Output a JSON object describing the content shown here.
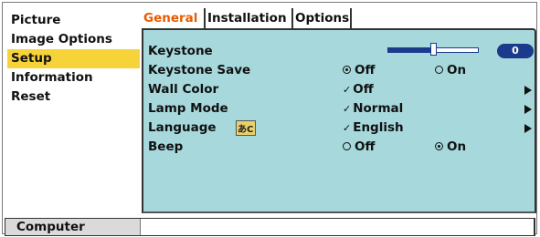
{
  "sidebar": {
    "items": [
      {
        "label": "Picture",
        "selected": false
      },
      {
        "label": "Image Options",
        "selected": false
      },
      {
        "label": "Setup",
        "selected": true
      },
      {
        "label": "Information",
        "selected": false
      },
      {
        "label": "Reset",
        "selected": false
      }
    ]
  },
  "tabs": [
    {
      "label": "General",
      "active": true
    },
    {
      "label": "Installation",
      "active": false
    },
    {
      "label": "Options",
      "active": false
    }
  ],
  "settings": {
    "keystone": {
      "label": "Keystone",
      "value": "0",
      "slider_fraction": 0.5
    },
    "keystone_save": {
      "label": "Keystone Save",
      "options": [
        "Off",
        "On"
      ],
      "selected": "Off"
    },
    "wall_color": {
      "label": "Wall Color",
      "value": "Off"
    },
    "lamp_mode": {
      "label": "Lamp Mode",
      "value": "Normal"
    },
    "language": {
      "label": "Language",
      "value": "English"
    },
    "beep": {
      "label": "Beep",
      "options": [
        "Off",
        "On"
      ],
      "selected": "On"
    }
  },
  "status": {
    "label": "Computer"
  },
  "colors": {
    "selected_highlight": "#f7d33a",
    "active_tab_text": "#e85a00",
    "panel_bg": "#a6d8dc",
    "slider": "#1b3a8c"
  },
  "icons": {
    "language": "language-globe-icon",
    "submenu": "arrow-right-icon",
    "check": "check-icon"
  }
}
